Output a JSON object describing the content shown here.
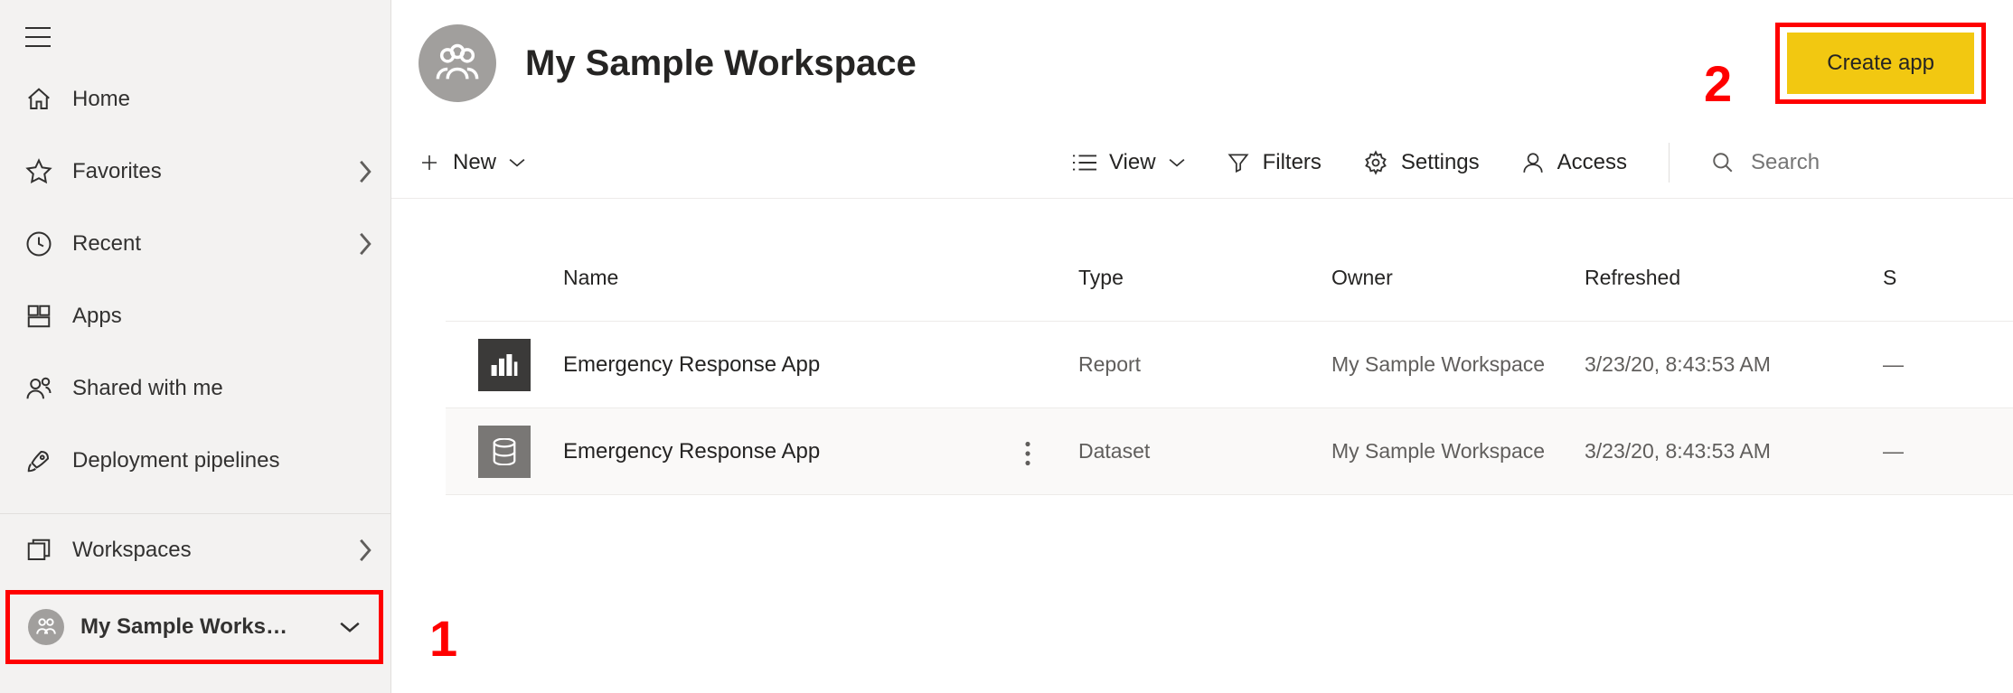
{
  "annotations": {
    "a1": "1",
    "a2": "2"
  },
  "sidebar": {
    "items": [
      {
        "label": "Home",
        "chev": false
      },
      {
        "label": "Favorites",
        "chev": true
      },
      {
        "label": "Recent",
        "chev": true
      },
      {
        "label": "Apps",
        "chev": false
      },
      {
        "label": "Shared with me",
        "chev": false
      },
      {
        "label": "Deployment pipelines",
        "chev": false
      }
    ],
    "workspaces_label": "Workspaces",
    "current_workspace": "My Sample Works…"
  },
  "header": {
    "title": "My Sample Workspace",
    "create_app": "Create app"
  },
  "toolbar": {
    "new": "New",
    "view": "View",
    "filters": "Filters",
    "settings": "Settings",
    "access": "Access",
    "search_placeholder": "Search"
  },
  "table": {
    "columns": {
      "name": "Name",
      "type": "Type",
      "owner": "Owner",
      "refreshed": "Refreshed",
      "s": "S"
    },
    "rows": [
      {
        "name": "Emergency Response App",
        "type": "Report",
        "owner": "My Sample Workspace",
        "refreshed": "3/23/20, 8:43:53 AM",
        "s": "—",
        "icon": "report",
        "more": false
      },
      {
        "name": "Emergency Response App",
        "type": "Dataset",
        "owner": "My Sample Workspace",
        "refreshed": "3/23/20, 8:43:53 AM",
        "s": "—",
        "icon": "dataset",
        "more": true
      }
    ]
  }
}
